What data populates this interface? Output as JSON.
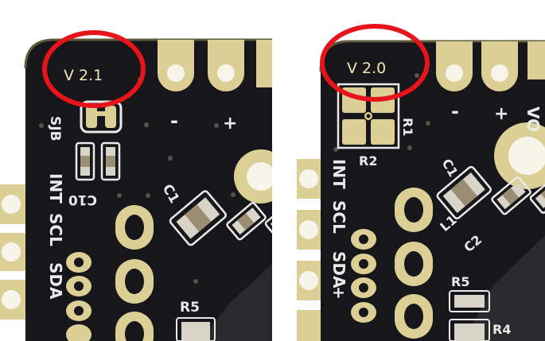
{
  "panels": [
    {
      "version_label": "V 2.1",
      "silk": {
        "sjb": "SJB",
        "c10": "C10",
        "int": "INT",
        "scl": "SCL",
        "sda": "SDA",
        "c1": "C1",
        "r5": "R5",
        "minus": "-",
        "plus": "+"
      }
    },
    {
      "version_label": "V 2.0",
      "silk": {
        "r1": "R1",
        "r2": "R2",
        "int": "INT",
        "scl": "SCL",
        "sda": "SDA",
        "c1": "C1",
        "l1": "L1",
        "c2": "C2",
        "r5": "R5",
        "r4": "R4",
        "minus": "-",
        "plus": "+",
        "vo": "VO"
      }
    }
  ],
  "colors": {
    "board": "#17161a",
    "gold": "#dccf95",
    "highlight_circle": "#e8141b",
    "silkscreen": "#e9e9e9"
  }
}
